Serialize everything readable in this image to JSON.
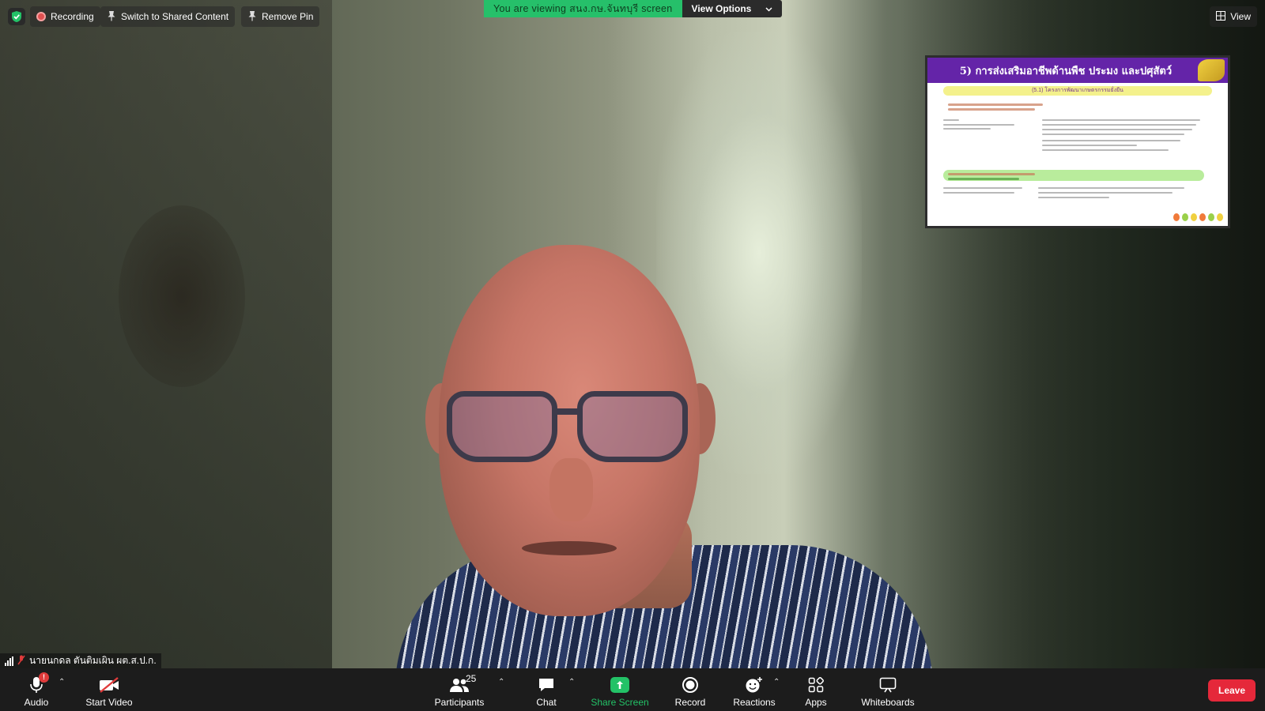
{
  "top_bar": {
    "recording_label": "Recording",
    "switch_label": "Switch to Shared Content",
    "remove_pin_label": "Remove Pin",
    "viewing_text": "You are viewing สนง.กษ.จันทบุรี screen",
    "view_options_label": "View Options",
    "view_label": "View"
  },
  "shared_slide": {
    "title": "5) การส่งเสริมอาชีพด้านพืช ประมง และปศุสัตว์",
    "subtitle": "(5.1) โครงการพัฒนาเกษตรกรรมยั่งยืน"
  },
  "name_tag": {
    "name": "นายนกดล ตันติมเผิน ผต.ส.ป.ก."
  },
  "toolbar": {
    "audio_label": "Audio",
    "audio_badge": "!",
    "video_label": "Start Video",
    "participants_label": "Participants",
    "participants_count": "25",
    "chat_label": "Chat",
    "share_label": "Share Screen",
    "record_label": "Record",
    "reactions_label": "Reactions",
    "apps_label": "Apps",
    "whiteboards_label": "Whiteboards",
    "leave_label": "Leave"
  },
  "colors": {
    "share_green": "#23c267",
    "banner_green": "#26c06a",
    "leave_red": "#e5283a",
    "slide_purple": "#6424a8"
  }
}
